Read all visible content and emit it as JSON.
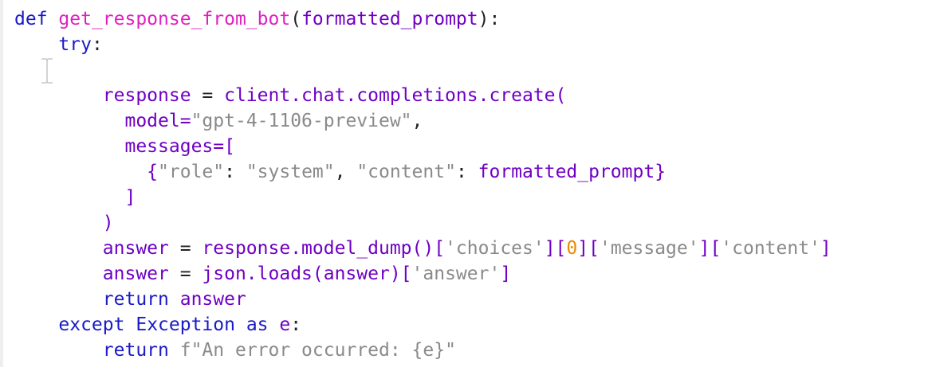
{
  "editor": {
    "line1": {
      "def": "def",
      "fn": "get_response_from_bot",
      "open": "(",
      "param": "formatted_prompt",
      "close": "):"
    },
    "line2": {
      "kw": "try",
      "colon": ":"
    },
    "line4": {
      "var": "response",
      "eq": " = ",
      "call": "client.chat.completions.create("
    },
    "line5": {
      "name": "model=",
      "str": "\"gpt-4-1106-preview\"",
      "comma": ","
    },
    "line6": {
      "text": "messages=["
    },
    "line7": {
      "open": "{",
      "k1": "\"role\"",
      "c1": ": ",
      "v1": "\"system\"",
      "sep": ", ",
      "k2": "\"content\"",
      "c2": ": ",
      "v2": "formatted_prompt",
      "close": "}"
    },
    "line8": {
      "text": "]"
    },
    "line9": {
      "text": ")"
    },
    "line10": {
      "var": "answer",
      "eq": " = ",
      "call": "response.model_dump()",
      "b1": "[",
      "s1": "'choices'",
      "b2": "][",
      "num": "0",
      "b3": "][",
      "s2": "'message'",
      "b4": "][",
      "s3": "'content'",
      "b5": "]"
    },
    "line11": {
      "var": "answer",
      "eq": " = ",
      "call": "json.loads(answer)",
      "b1": "[",
      "s1": "'answer'",
      "b2": "]"
    },
    "line12": {
      "kw": "return",
      "val": "answer"
    },
    "line13": {
      "kw": "except",
      "exc": "Exception",
      "as": "as",
      "var": "e",
      "colon": ":"
    },
    "line14": {
      "kw": "return",
      "str": "f\"An error occurred: {e}\""
    }
  }
}
